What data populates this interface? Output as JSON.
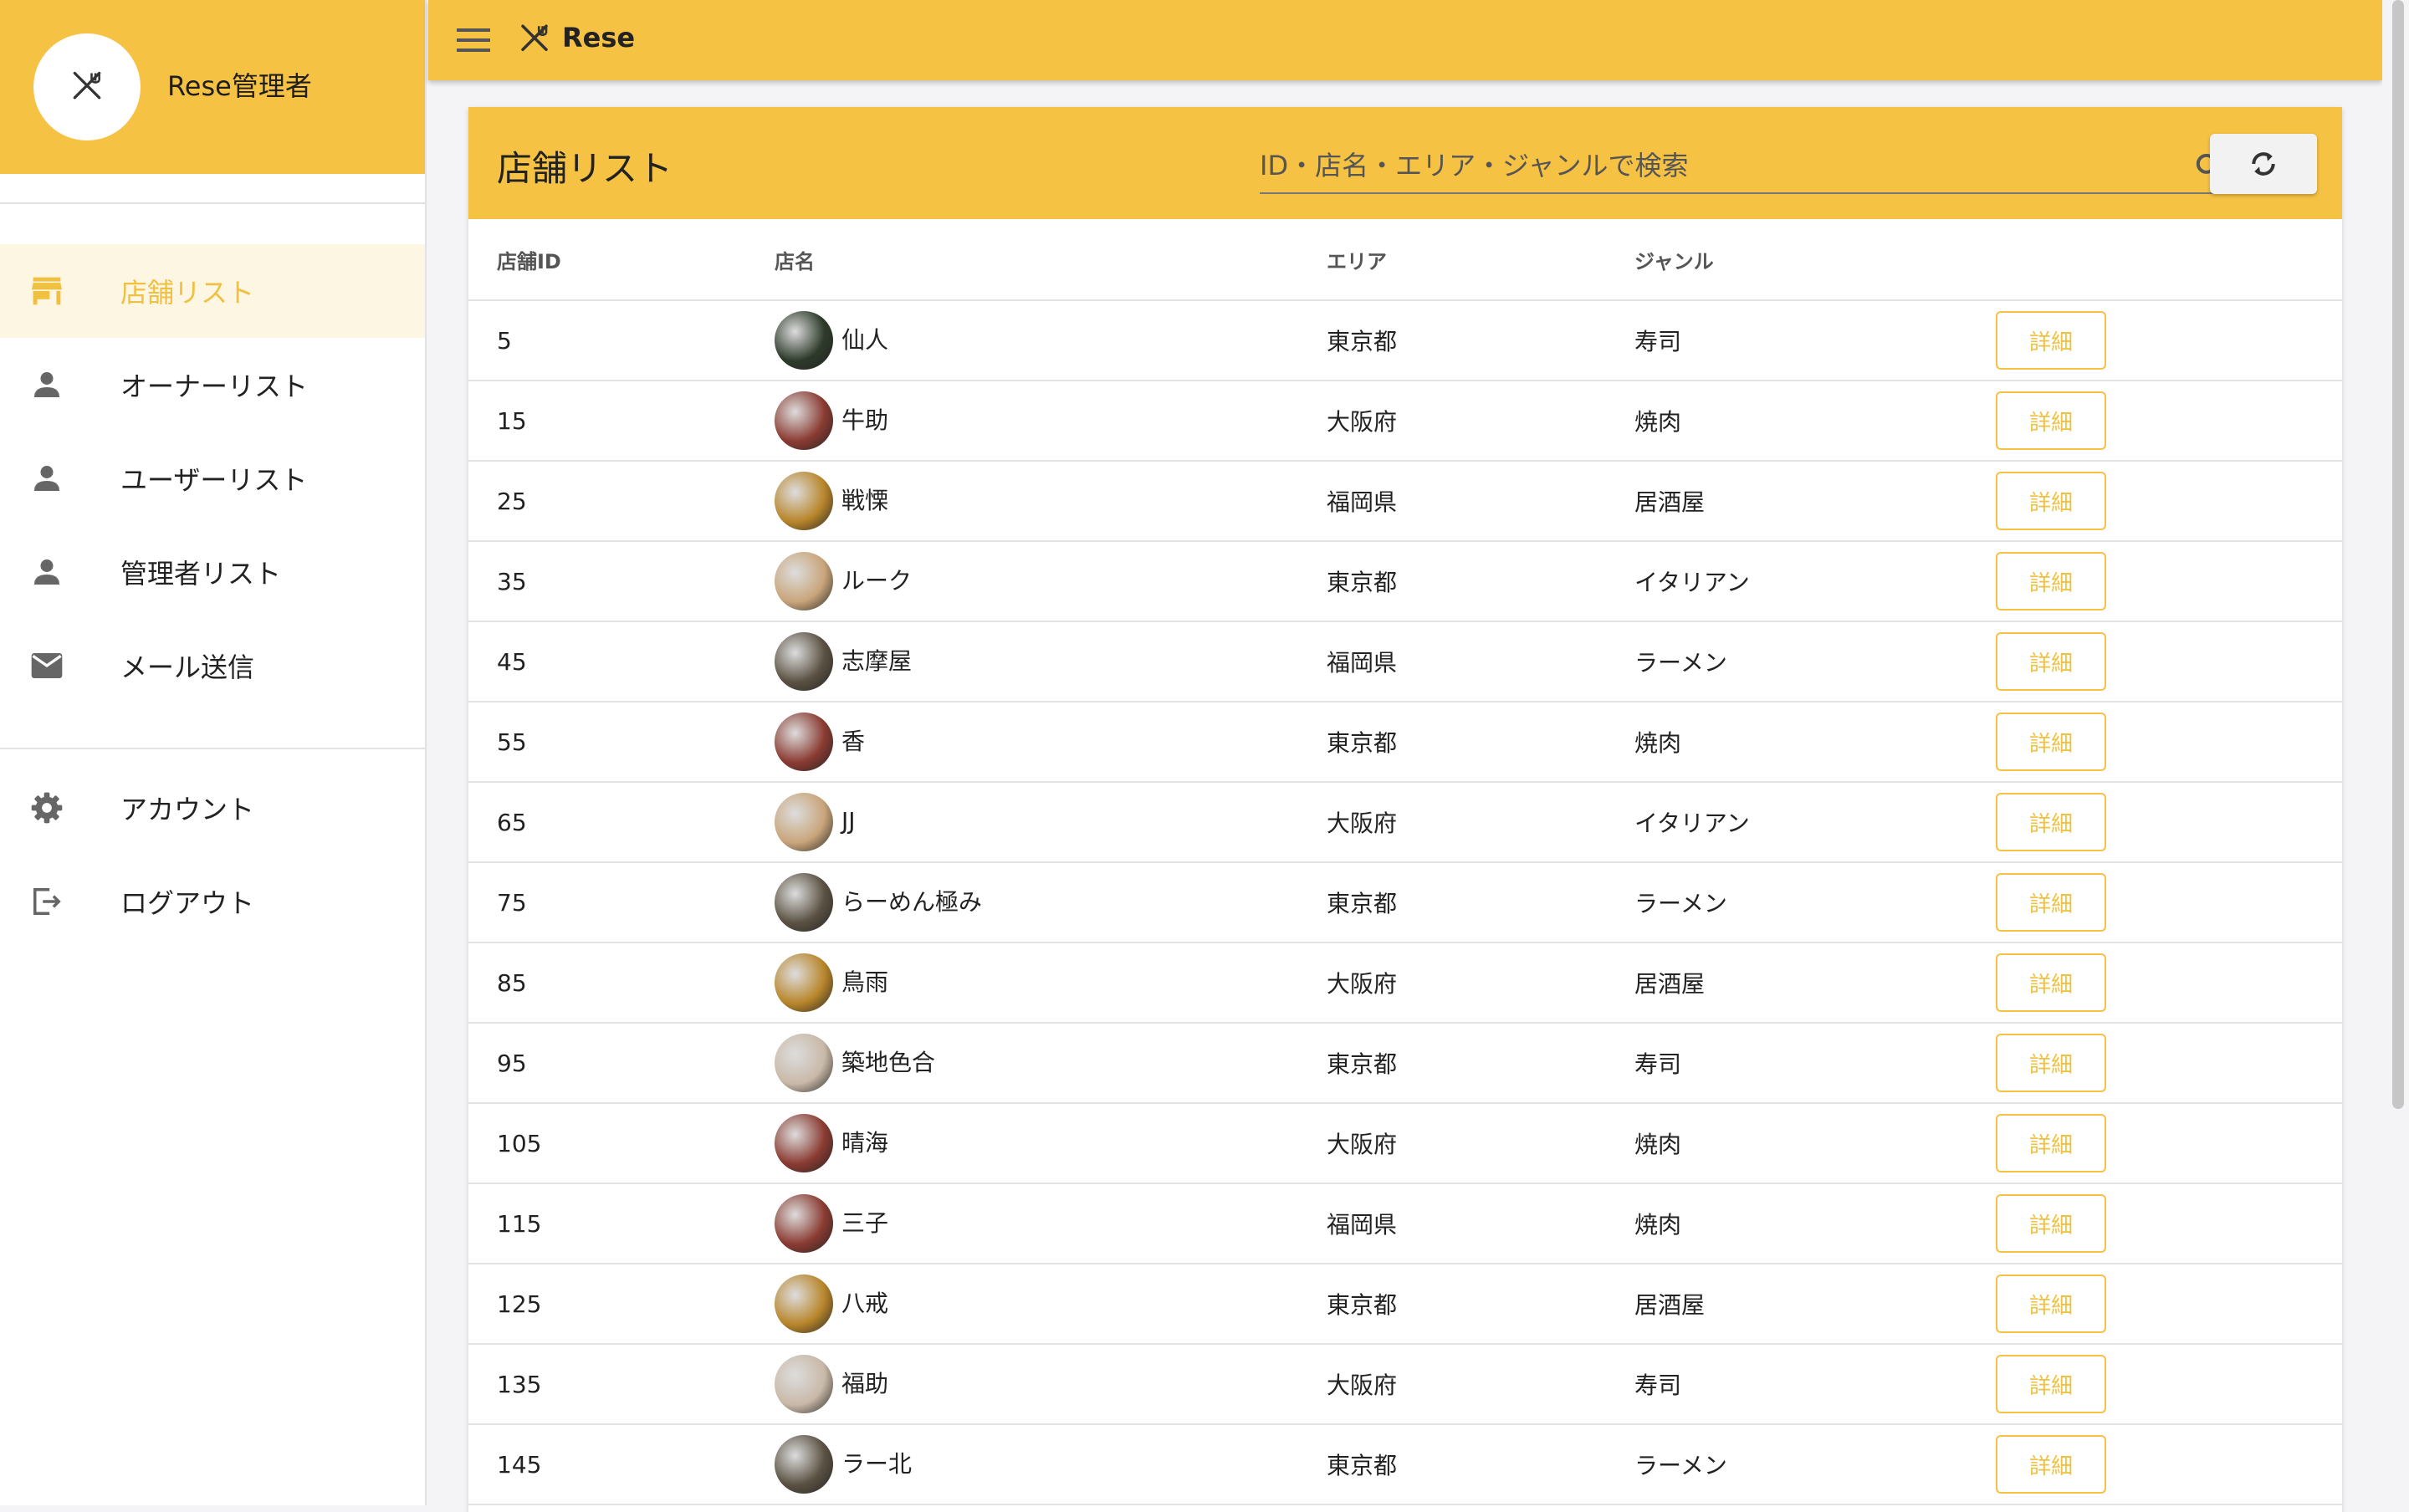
{
  "app": {
    "brand": "Rese",
    "admin_title": "Rese管理者"
  },
  "colors": {
    "primary": "#f6c244",
    "active_text": "#f0c040",
    "active_bg": "#fdf6e3"
  },
  "sidebar": {
    "items": [
      {
        "label": "店舗リスト",
        "icon": "store-icon",
        "active": true
      },
      {
        "label": "オーナーリスト",
        "icon": "person-icon"
      },
      {
        "label": "ユーザーリスト",
        "icon": "person-icon"
      },
      {
        "label": "管理者リスト",
        "icon": "person-icon"
      },
      {
        "label": "メール送信",
        "icon": "mail-icon"
      }
    ],
    "bottom_items": [
      {
        "label": "アカウント",
        "icon": "gear-icon"
      },
      {
        "label": "ログアウト",
        "icon": "logout-icon"
      }
    ]
  },
  "card": {
    "title": "店舗リスト",
    "search_placeholder": "ID・店名・エリア・ジャンルで検索"
  },
  "table": {
    "headers": [
      "店舗ID",
      "店名",
      "エリア",
      "ジャンル"
    ],
    "detail_label": "詳細",
    "rows": [
      {
        "id": "5",
        "name": "仙人",
        "area": "東京都",
        "genre": "寿司",
        "thumb": "#2d3a2a"
      },
      {
        "id": "15",
        "name": "牛助",
        "area": "大阪府",
        "genre": "焼肉",
        "thumb": "#8a3b32"
      },
      {
        "id": "25",
        "name": "戦慄",
        "area": "福岡県",
        "genre": "居酒屋",
        "thumb": "#b8862b"
      },
      {
        "id": "35",
        "name": "ルーク",
        "area": "東京都",
        "genre": "イタリアン",
        "thumb": "#c9a57a"
      },
      {
        "id": "45",
        "name": "志摩屋",
        "area": "福岡県",
        "genre": "ラーメン",
        "thumb": "#5a5142"
      },
      {
        "id": "55",
        "name": "香",
        "area": "東京都",
        "genre": "焼肉",
        "thumb": "#8a3b32"
      },
      {
        "id": "65",
        "name": "JJ",
        "area": "大阪府",
        "genre": "イタリアン",
        "thumb": "#c9a57a"
      },
      {
        "id": "75",
        "name": "らーめん極み",
        "area": "東京都",
        "genre": "ラーメン",
        "thumb": "#5a5142"
      },
      {
        "id": "85",
        "name": "鳥雨",
        "area": "大阪府",
        "genre": "居酒屋",
        "thumb": "#b8862b"
      },
      {
        "id": "95",
        "name": "築地色合",
        "area": "東京都",
        "genre": "寿司",
        "thumb": "#c9b9a8"
      },
      {
        "id": "105",
        "name": "晴海",
        "area": "大阪府",
        "genre": "焼肉",
        "thumb": "#8a3b32"
      },
      {
        "id": "115",
        "name": "三子",
        "area": "福岡県",
        "genre": "焼肉",
        "thumb": "#8a3b32"
      },
      {
        "id": "125",
        "name": "八戒",
        "area": "東京都",
        "genre": "居酒屋",
        "thumb": "#b8862b"
      },
      {
        "id": "135",
        "name": "福助",
        "area": "大阪府",
        "genre": "寿司",
        "thumb": "#c9b9a8"
      },
      {
        "id": "145",
        "name": "ラー北",
        "area": "東京都",
        "genre": "ラーメン",
        "thumb": "#5a5142"
      }
    ]
  }
}
